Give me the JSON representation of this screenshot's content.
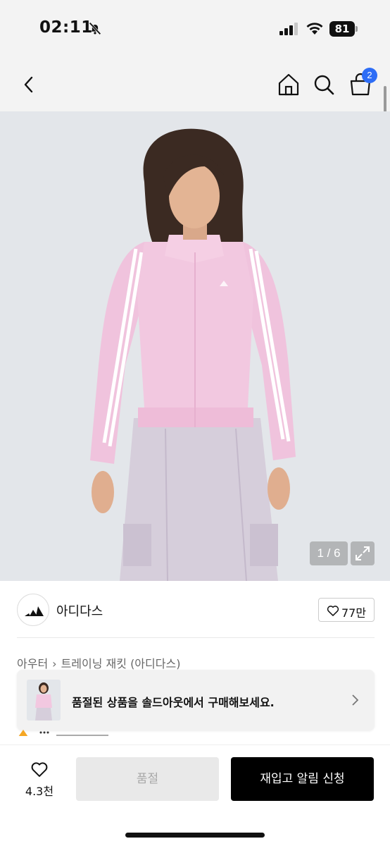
{
  "status_bar": {
    "time": "02:11",
    "battery": "81",
    "icons": [
      "bell-off-icon",
      "signal-icon",
      "wifi-icon",
      "battery-icon"
    ]
  },
  "header": {
    "icons": [
      "back-icon",
      "home-icon",
      "search-icon",
      "cart-icon"
    ],
    "cart_badge": "2"
  },
  "gallery": {
    "counter": "1 / 6",
    "current": 1,
    "total": 6,
    "expand_icon": "expand-icon"
  },
  "brand": {
    "name": "아디다스",
    "like_count": "77만",
    "logo_icon": "adidas-logo-icon"
  },
  "breadcrumb": {
    "items": [
      "아우터",
      "트레이닝 재킷 (아디다스)"
    ]
  },
  "soldout_banner": {
    "text": "품절된 상품을 솔드아웃에서 구매해보세요."
  },
  "bottom_bar": {
    "wish_count": "4.3천",
    "soldout_label": "품절",
    "restock_label": "재입고 알림 신청"
  },
  "colors": {
    "accent_badge": "#2d6df6",
    "primary_button": "#000000",
    "disabled_button": "#e9e9e9",
    "jacket_pink": "#f2c8e0",
    "image_background": "#e3e6ea"
  }
}
